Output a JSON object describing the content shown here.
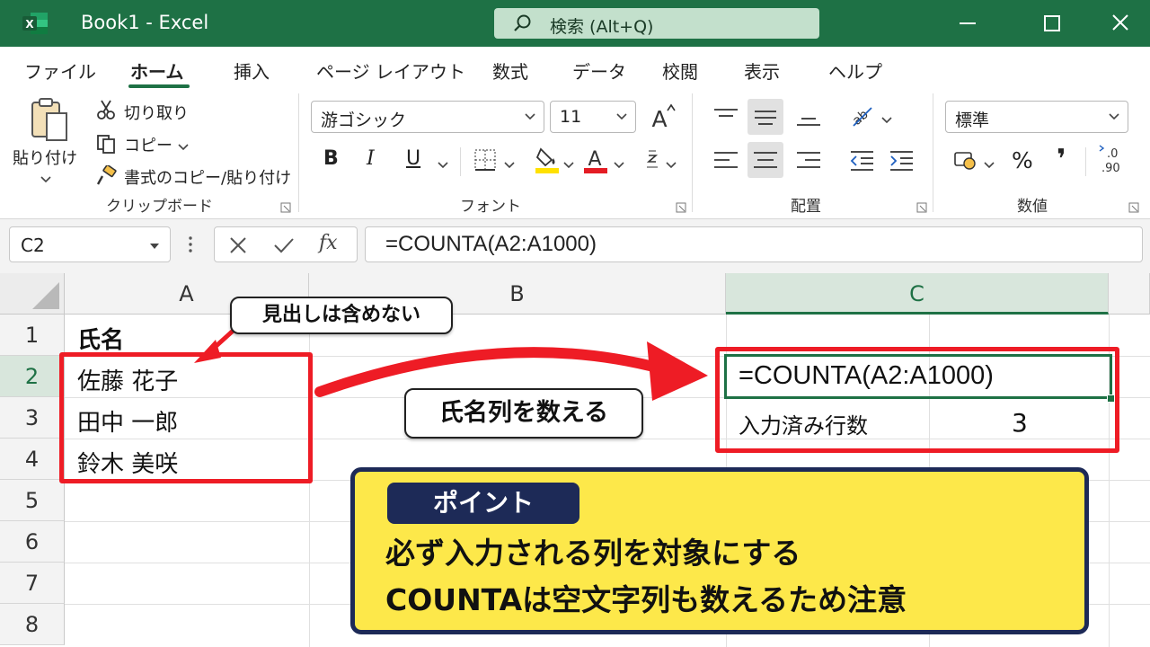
{
  "titlebar": {
    "app_title": "Book1  -  Excel",
    "search_placeholder": "検索 (Alt+Q)",
    "logo_letter": "X"
  },
  "ribbon_tabs": [
    "ファイル",
    "ホーム",
    "挿入",
    "ページ レイアウト",
    "数式",
    "データ",
    "校閲",
    "表示",
    "ヘルプ"
  ],
  "active_tab": "ホーム",
  "clipboard": {
    "paste": "貼り付け",
    "cut": "切り取り",
    "copy": "コピー",
    "format_painter": "書式のコピー/貼り付け",
    "label": "クリップボード"
  },
  "font_group": {
    "font_name": "游ゴシック",
    "font_size": "11",
    "label": "フォント",
    "bold": "B",
    "italic": "I",
    "underline": "U",
    "font_color_letter": "A",
    "grow_letter": "A"
  },
  "alignment_group": {
    "label": "配置"
  },
  "number_group": {
    "format": "標準",
    "label": "数値",
    "percent": "%",
    "comma": "❜"
  },
  "formula_bar": {
    "name_box": "C2",
    "fx": "fx",
    "formula": "=COUNTA(A2:A1000)"
  },
  "columns": [
    "A",
    "B",
    "C"
  ],
  "rows": [
    "1",
    "2",
    "3",
    "4",
    "5",
    "6",
    "7",
    "8"
  ],
  "cells": {
    "A1": "氏名",
    "A2": "佐藤 花子",
    "A3": "田中 一郎",
    "A4": "鈴木 美咲",
    "C2": "=COUNTA(A2:A1000)",
    "C3": "入力済み行数",
    "D3": "3"
  },
  "annotations": {
    "header_note": "見出しは含めない",
    "arrow_note": "氏名列を数える"
  },
  "point": {
    "tag": "ポイント",
    "line1": "必ず入力される列を対象にする",
    "line2": "COUNTAは空文字列も数えるため注意"
  },
  "colors": {
    "excel_green": "#1e7145",
    "highlight_red": "#ee1c25",
    "point_yellow": "#fde84a",
    "point_navy": "#1d2a57"
  }
}
